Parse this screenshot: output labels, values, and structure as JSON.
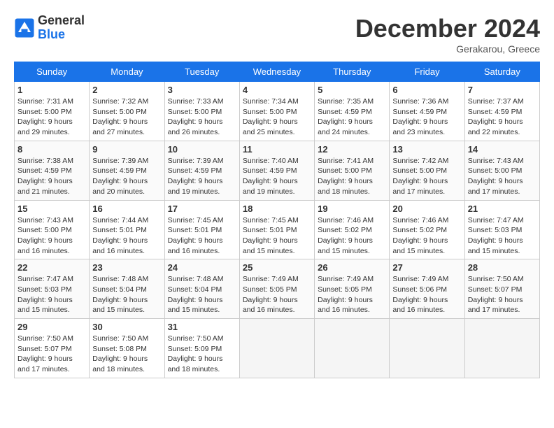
{
  "header": {
    "logo_line1": "General",
    "logo_line2": "Blue",
    "month": "December 2024",
    "location": "Gerakarou, Greece"
  },
  "weekdays": [
    "Sunday",
    "Monday",
    "Tuesday",
    "Wednesday",
    "Thursday",
    "Friday",
    "Saturday"
  ],
  "weeks": [
    [
      {
        "day": 1,
        "sunrise": "7:31 AM",
        "sunset": "5:00 PM",
        "daylight": "9 hours and 29 minutes."
      },
      {
        "day": 2,
        "sunrise": "7:32 AM",
        "sunset": "5:00 PM",
        "daylight": "9 hours and 27 minutes."
      },
      {
        "day": 3,
        "sunrise": "7:33 AM",
        "sunset": "5:00 PM",
        "daylight": "9 hours and 26 minutes."
      },
      {
        "day": 4,
        "sunrise": "7:34 AM",
        "sunset": "5:00 PM",
        "daylight": "9 hours and 25 minutes."
      },
      {
        "day": 5,
        "sunrise": "7:35 AM",
        "sunset": "4:59 PM",
        "daylight": "9 hours and 24 minutes."
      },
      {
        "day": 6,
        "sunrise": "7:36 AM",
        "sunset": "4:59 PM",
        "daylight": "9 hours and 23 minutes."
      },
      {
        "day": 7,
        "sunrise": "7:37 AM",
        "sunset": "4:59 PM",
        "daylight": "9 hours and 22 minutes."
      }
    ],
    [
      {
        "day": 8,
        "sunrise": "7:38 AM",
        "sunset": "4:59 PM",
        "daylight": "9 hours and 21 minutes."
      },
      {
        "day": 9,
        "sunrise": "7:39 AM",
        "sunset": "4:59 PM",
        "daylight": "9 hours and 20 minutes."
      },
      {
        "day": 10,
        "sunrise": "7:39 AM",
        "sunset": "4:59 PM",
        "daylight": "9 hours and 19 minutes."
      },
      {
        "day": 11,
        "sunrise": "7:40 AM",
        "sunset": "4:59 PM",
        "daylight": "9 hours and 19 minutes."
      },
      {
        "day": 12,
        "sunrise": "7:41 AM",
        "sunset": "5:00 PM",
        "daylight": "9 hours and 18 minutes."
      },
      {
        "day": 13,
        "sunrise": "7:42 AM",
        "sunset": "5:00 PM",
        "daylight": "9 hours and 17 minutes."
      },
      {
        "day": 14,
        "sunrise": "7:43 AM",
        "sunset": "5:00 PM",
        "daylight": "9 hours and 17 minutes."
      }
    ],
    [
      {
        "day": 15,
        "sunrise": "7:43 AM",
        "sunset": "5:00 PM",
        "daylight": "9 hours and 16 minutes."
      },
      {
        "day": 16,
        "sunrise": "7:44 AM",
        "sunset": "5:01 PM",
        "daylight": "9 hours and 16 minutes."
      },
      {
        "day": 17,
        "sunrise": "7:45 AM",
        "sunset": "5:01 PM",
        "daylight": "9 hours and 16 minutes."
      },
      {
        "day": 18,
        "sunrise": "7:45 AM",
        "sunset": "5:01 PM",
        "daylight": "9 hours and 15 minutes."
      },
      {
        "day": 19,
        "sunrise": "7:46 AM",
        "sunset": "5:02 PM",
        "daylight": "9 hours and 15 minutes."
      },
      {
        "day": 20,
        "sunrise": "7:46 AM",
        "sunset": "5:02 PM",
        "daylight": "9 hours and 15 minutes."
      },
      {
        "day": 21,
        "sunrise": "7:47 AM",
        "sunset": "5:03 PM",
        "daylight": "9 hours and 15 minutes."
      }
    ],
    [
      {
        "day": 22,
        "sunrise": "7:47 AM",
        "sunset": "5:03 PM",
        "daylight": "9 hours and 15 minutes."
      },
      {
        "day": 23,
        "sunrise": "7:48 AM",
        "sunset": "5:04 PM",
        "daylight": "9 hours and 15 minutes."
      },
      {
        "day": 24,
        "sunrise": "7:48 AM",
        "sunset": "5:04 PM",
        "daylight": "9 hours and 15 minutes."
      },
      {
        "day": 25,
        "sunrise": "7:49 AM",
        "sunset": "5:05 PM",
        "daylight": "9 hours and 16 minutes."
      },
      {
        "day": 26,
        "sunrise": "7:49 AM",
        "sunset": "5:05 PM",
        "daylight": "9 hours and 16 minutes."
      },
      {
        "day": 27,
        "sunrise": "7:49 AM",
        "sunset": "5:06 PM",
        "daylight": "9 hours and 16 minutes."
      },
      {
        "day": 28,
        "sunrise": "7:50 AM",
        "sunset": "5:07 PM",
        "daylight": "9 hours and 17 minutes."
      }
    ],
    [
      {
        "day": 29,
        "sunrise": "7:50 AM",
        "sunset": "5:07 PM",
        "daylight": "9 hours and 17 minutes."
      },
      {
        "day": 30,
        "sunrise": "7:50 AM",
        "sunset": "5:08 PM",
        "daylight": "9 hours and 18 minutes."
      },
      {
        "day": 31,
        "sunrise": "7:50 AM",
        "sunset": "5:09 PM",
        "daylight": "9 hours and 18 minutes."
      },
      null,
      null,
      null,
      null
    ]
  ]
}
